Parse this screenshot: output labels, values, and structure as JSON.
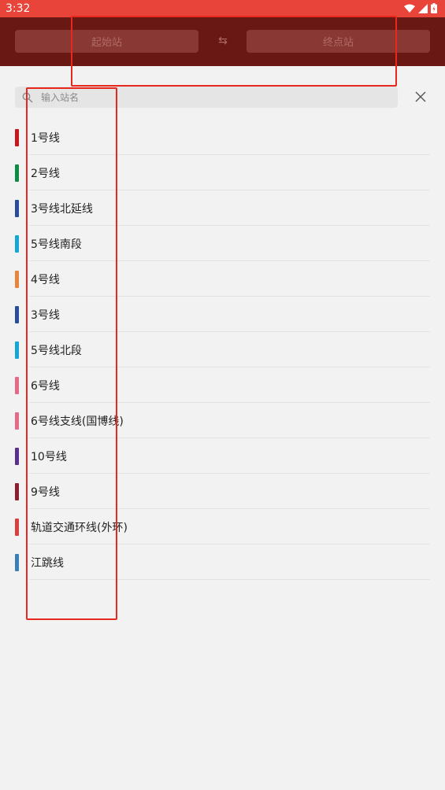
{
  "status": {
    "time": "3:32"
  },
  "header": {
    "start_label": "起始站",
    "swap_icon": "swap-arrows-icon",
    "end_label": "终点站"
  },
  "search": {
    "placeholder": "输入站名"
  },
  "lines": [
    {
      "label": "1号线",
      "color": "#c8161d"
    },
    {
      "label": "2号线",
      "color": "#0e8a43"
    },
    {
      "label": "3号线北延线",
      "color": "#2a4d9b"
    },
    {
      "label": "5号线南段",
      "color": "#16a6d6"
    },
    {
      "label": "4号线",
      "color": "#e8853c"
    },
    {
      "label": "3号线",
      "color": "#2a4d9b"
    },
    {
      "label": "5号线北段",
      "color": "#16a6d6"
    },
    {
      "label": "6号线",
      "color": "#e46a8a"
    },
    {
      "label": "6号线支线(国博线)",
      "color": "#e46a8a"
    },
    {
      "label": "10号线",
      "color": "#5b2f8e"
    },
    {
      "label": "9号线",
      "color": "#8c1f2e"
    },
    {
      "label": "轨道交通环线(外环)",
      "color": "#d84040"
    },
    {
      "label": "江跳线",
      "color": "#3b7fb8"
    }
  ]
}
